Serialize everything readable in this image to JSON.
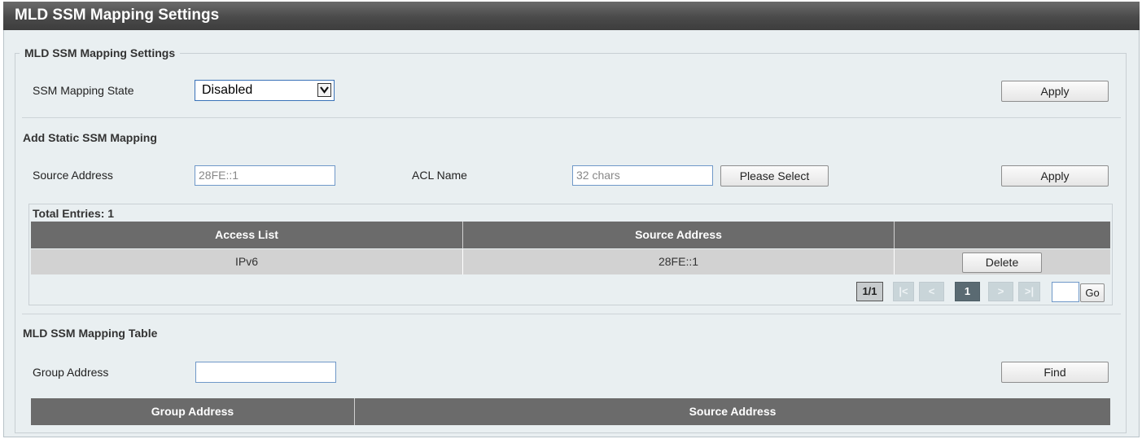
{
  "page": {
    "title": "MLD SSM Mapping Settings"
  },
  "settings": {
    "legend": "MLD SSM Mapping Settings",
    "state_label": "SSM Mapping State",
    "state_value": "Disabled",
    "apply_label": "Apply"
  },
  "add_static": {
    "title": "Add Static SSM Mapping",
    "source_label": "Source Address",
    "source_value": "28FE::1",
    "acl_label": "ACL Name",
    "acl_placeholder": "32 chars",
    "select_label": "Please Select",
    "apply_label": "Apply"
  },
  "static_table": {
    "total_entries": "Total Entries: 1",
    "columns": [
      "Access List",
      "Source Address",
      ""
    ],
    "rows": [
      {
        "access_list": "IPv6",
        "source_address": "28FE::1",
        "action": "Delete"
      }
    ],
    "pagination": {
      "total": "1/1",
      "first": "|<",
      "prev": "<",
      "current": "1",
      "next": ">",
      "last": ">|",
      "go_label": "Go",
      "page_input": ""
    }
  },
  "mapping_table": {
    "title": "MLD SSM Mapping Table",
    "group_label": "Group Address",
    "group_value": "",
    "find_label": "Find",
    "columns": [
      "Group Address",
      "Source Address"
    ]
  }
}
